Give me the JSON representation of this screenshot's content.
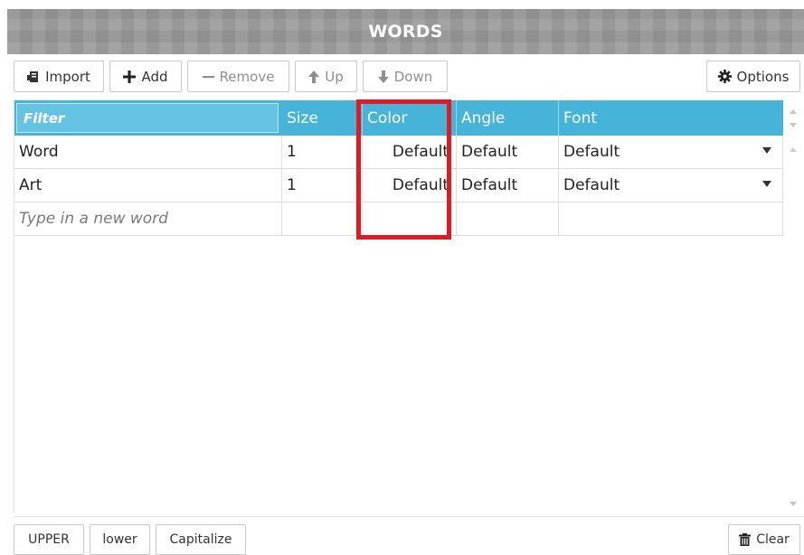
{
  "panel": {
    "title": "WORDS"
  },
  "toolbar": {
    "import_label": "Import",
    "add_label": "Add",
    "remove_label": "Remove",
    "up_label": "Up",
    "down_label": "Down",
    "options_label": "Options"
  },
  "table": {
    "filter_placeholder": "Filter",
    "columns": [
      "Size",
      "Color",
      "Angle",
      "Font"
    ],
    "rows": [
      {
        "word": "Word",
        "size": "1",
        "color": "Default",
        "angle": "Default",
        "font": "Default"
      },
      {
        "word": "Art",
        "size": "1",
        "color": "Default",
        "angle": "Default",
        "font": "Default"
      }
    ],
    "new_word_placeholder": "Type in a new word"
  },
  "bottom_bar": {
    "upper_label": "UPPER",
    "lower_label": "lower",
    "capitalize_label": "Capitalize",
    "clear_label": "Clear"
  },
  "colors": {
    "header_blue": "#46b3d8",
    "highlight_red": "#e01b24",
    "panel_gray": "#9a9a9a"
  },
  "icons": {
    "import": "import-icon",
    "add": "plus-icon",
    "remove": "minus-icon",
    "up": "arrow-up-icon",
    "down": "arrow-down-icon",
    "options": "gear-icon",
    "clear": "trash-icon"
  }
}
